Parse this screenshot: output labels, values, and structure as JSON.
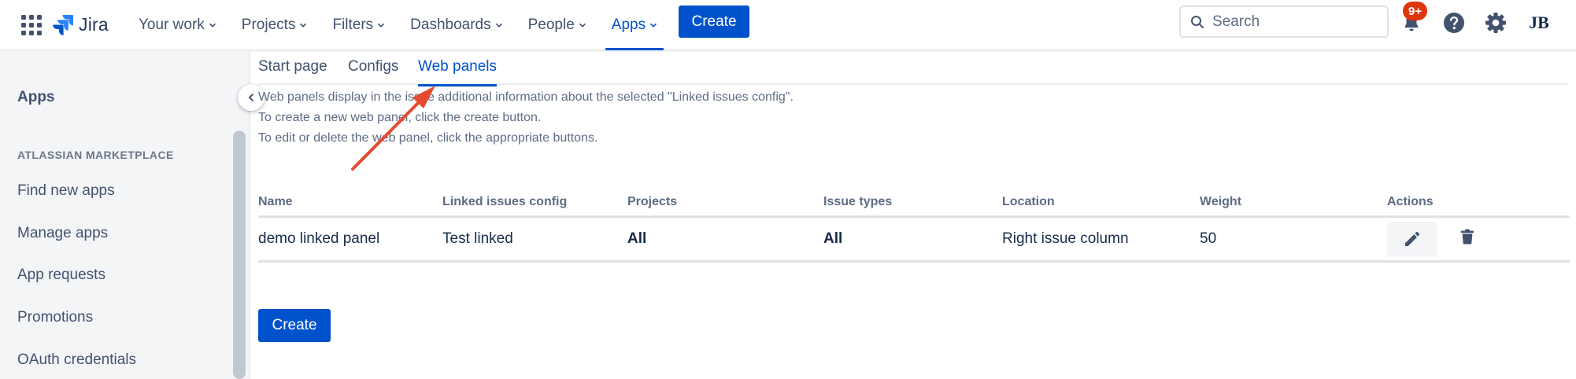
{
  "header": {
    "logo_text": "Jira",
    "nav": [
      {
        "label": "Your work"
      },
      {
        "label": "Projects"
      },
      {
        "label": "Filters"
      },
      {
        "label": "Dashboards"
      },
      {
        "label": "People"
      },
      {
        "label": "Apps",
        "active": true
      }
    ],
    "create_label": "Create",
    "search_placeholder": "Search",
    "notifications_badge": "9+",
    "icons": [
      "app-switcher-icon",
      "jira-logo-icon",
      "search-icon",
      "bell-icon",
      "help-icon",
      "settings-icon",
      "avatar-icon"
    ]
  },
  "sidebar": {
    "title": "Apps",
    "section": "ATLASSIAN MARKETPLACE",
    "items": [
      {
        "label": "Find new apps"
      },
      {
        "label": "Manage apps"
      },
      {
        "label": "App requests"
      },
      {
        "label": "Promotions"
      },
      {
        "label": "OAuth credentials"
      }
    ]
  },
  "tabs": [
    {
      "label": "Start page"
    },
    {
      "label": "Configs"
    },
    {
      "label": "Web panels",
      "active": true
    }
  ],
  "description": [
    "Web panels display in the issue additional information about the selected \"Linked issues config\".",
    "To create a new web panel, click the create button.",
    "To edit or delete the web panel, click the appropriate buttons."
  ],
  "table": {
    "columns": [
      "Name",
      "Linked issues config",
      "Projects",
      "Issue types",
      "Location",
      "Weight",
      "Actions"
    ],
    "rows": [
      {
        "name": "demo linked panel",
        "linked_issues_config": "Test linked",
        "projects": "All",
        "issue_types": "All",
        "location": "Right issue column",
        "weight": "50"
      }
    ]
  },
  "create_label": "Create",
  "colors": {
    "primary": "#0052cc",
    "text": "#172b4d",
    "subtle_text": "#42526e",
    "badge": "#de350b",
    "annotation": "#e34a2f"
  }
}
